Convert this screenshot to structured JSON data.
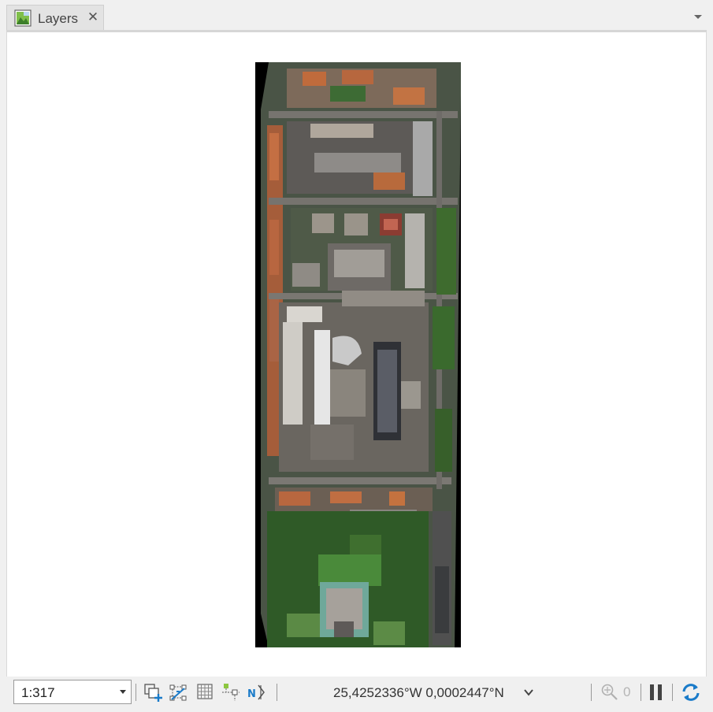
{
  "tab": {
    "label": "Layers",
    "icon": "map-icon",
    "close_icon": "close-icon"
  },
  "panel_menu_icon": "chevron-down-icon",
  "map": {
    "layer": "orthophoto-raster"
  },
  "status_bar": {
    "scale": "1:317",
    "coordinates": "25,4252336°W 0,0002447°N",
    "selected_count": "0",
    "tools": [
      "add-layer-icon",
      "edit-vertices-icon",
      "grid-icon",
      "snapping-icon",
      "north-arrow-icon"
    ]
  },
  "colors": {
    "accent": "#1a7bc9",
    "tab_bg": "#e3e3e3",
    "chrome_bg": "#f0f0f0"
  }
}
